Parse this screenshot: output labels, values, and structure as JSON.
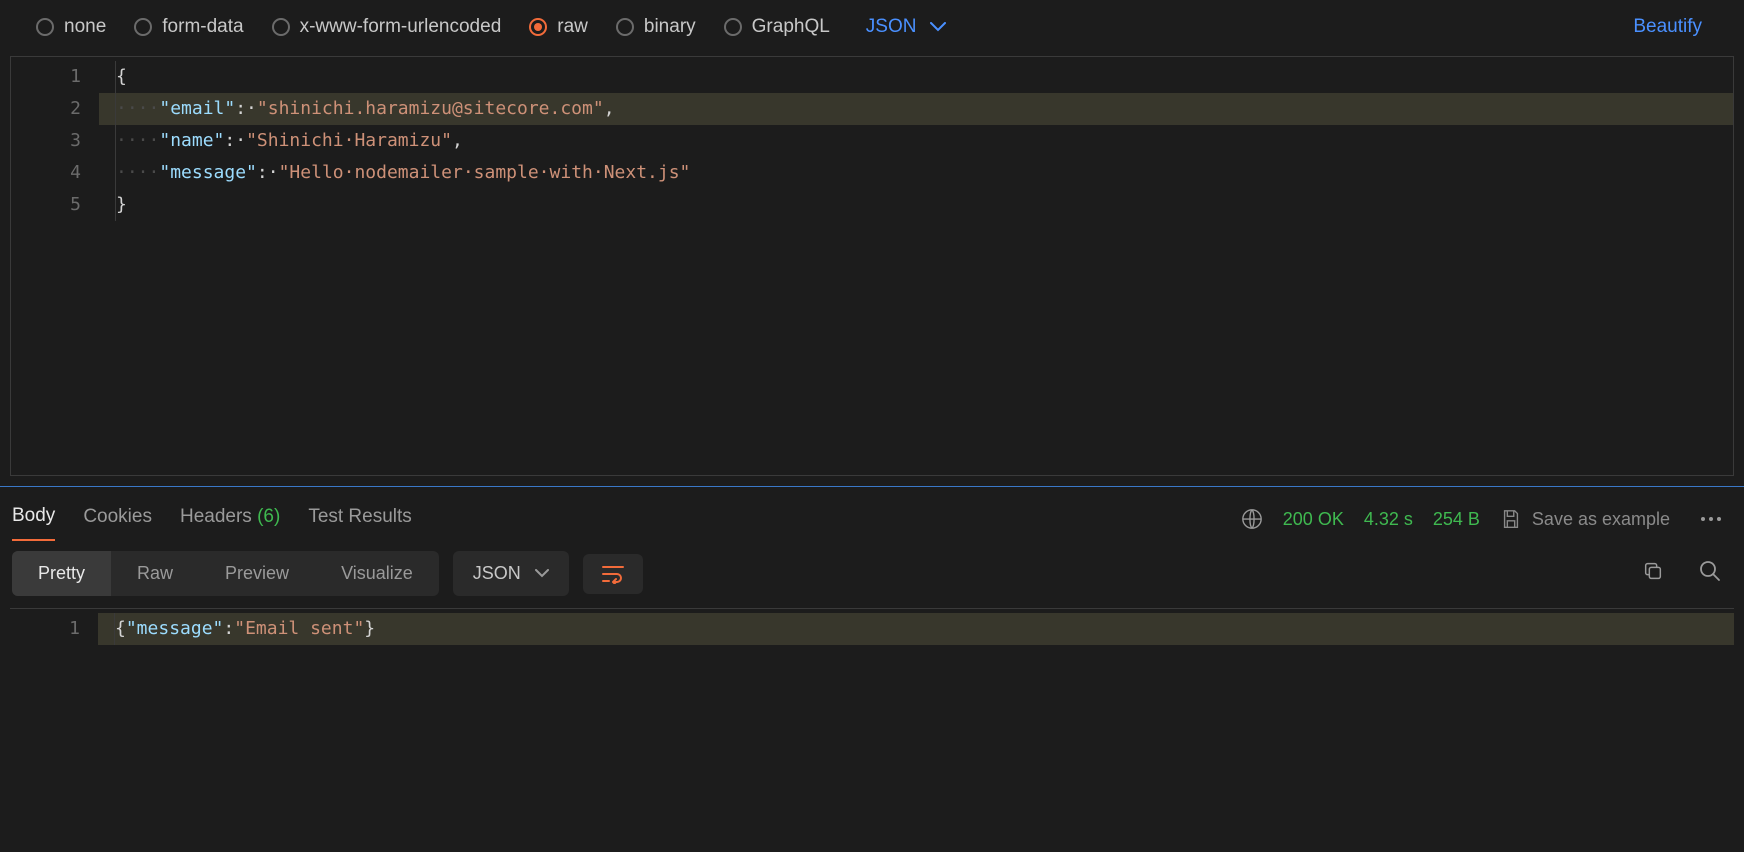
{
  "bodyTypes": {
    "none": "none",
    "formData": "form-data",
    "urlencoded": "x-www-form-urlencoded",
    "raw": "raw",
    "binary": "binary",
    "graphql": "GraphQL"
  },
  "rawType": "JSON",
  "beautify": "Beautify",
  "requestCode": {
    "l1": "{",
    "l2": {
      "indent": "····",
      "key": "\"email\"",
      "colon": ":·",
      "val": "\"shinichi.haramizu@sitecore.com\"",
      "comma": ","
    },
    "l3": {
      "indent": "····",
      "key": "\"name\"",
      "colon": ":·",
      "val": "\"Shinichi·Haramizu\"",
      "comma": ","
    },
    "l4": {
      "indent": "····",
      "key": "\"message\"",
      "colon": ":·",
      "val": "\"Hello·nodemailer·sample·with·Next.js\""
    },
    "l5": "}",
    "lineNums": [
      "1",
      "2",
      "3",
      "4",
      "5"
    ]
  },
  "responseTabs": {
    "body": "Body",
    "cookies": "Cookies",
    "headers": "Headers",
    "headersCount": "(6)",
    "testResults": "Test Results"
  },
  "status": {
    "code": "200 OK",
    "time": "4.32 s",
    "size": "254 B",
    "save": "Save as example"
  },
  "viewModes": {
    "pretty": "Pretty",
    "raw": "Raw",
    "preview": "Preview",
    "visualize": "Visualize",
    "respType": "JSON"
  },
  "responseCode": {
    "lineNum": "1",
    "open": "{",
    "key": "\"message\"",
    "colon": ":",
    "val": "\"Email sent\"",
    "close": "}"
  }
}
